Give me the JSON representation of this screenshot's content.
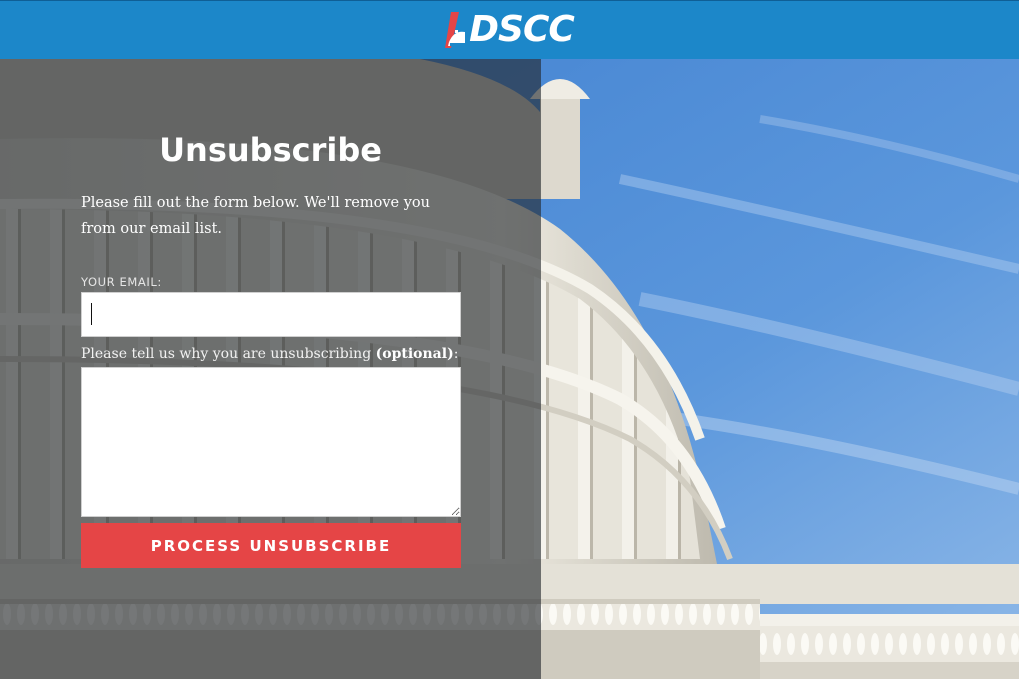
{
  "header": {
    "logo_text": "DSCC",
    "colors": {
      "bar": "#1c87c9",
      "logo_accent_red": "#e54546",
      "logo_text": "#ffffff"
    }
  },
  "form": {
    "title": "Unsubscribe",
    "intro": "Please fill out the form below. We'll remove you from our email list.",
    "email_label": "YOUR EMAIL:",
    "email_value": "",
    "email_placeholder": "",
    "reason_label_prefix": "Please tell us why you are unsubscribing ",
    "reason_label_optional": "(optional)",
    "reason_label_suffix": ":",
    "reason_value": "",
    "submit_label": "PROCESS UNSUBSCRIBE",
    "colors": {
      "submit_button": "#e54546",
      "panel_overlay": "#22262c"
    }
  },
  "background": {
    "icon": "capitol-dome-photo",
    "sky_color": "#4f8fd6"
  }
}
